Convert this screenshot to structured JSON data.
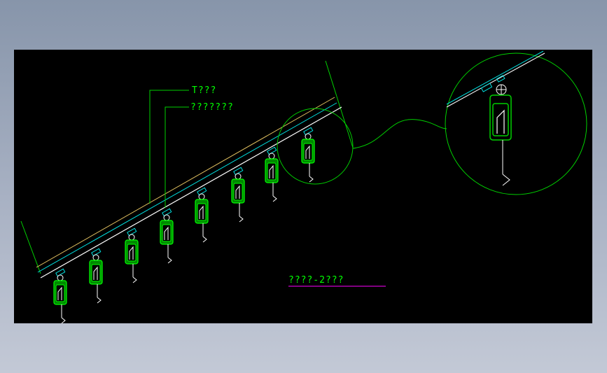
{
  "drawing": {
    "label_top": "T???",
    "label_second": "???????",
    "caption": "????-2???"
  },
  "colors": {
    "background": "#000000",
    "line_green": "#00d000",
    "line_white": "#ffffff",
    "line_cyan": "#00e0e0",
    "line_yellow": "#e0c060",
    "caption_green": "#00ff00",
    "caption_underline": "#ff00ff",
    "device_fill": "#00b000"
  },
  "icons": {
    "device": "hanger-sprinkler-icon",
    "detail": "magnifier-detail-circle"
  }
}
